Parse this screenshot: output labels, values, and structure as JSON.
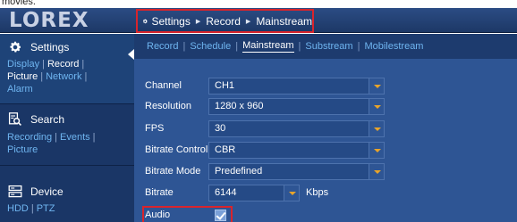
{
  "caption": "movies.",
  "header": {
    "logo": "LOREX",
    "breadcrumb": [
      "Settings",
      "Record",
      "Mainstream"
    ],
    "highlight_color": "#d8242c"
  },
  "sidebar": {
    "settings": {
      "title": "Settings",
      "links_row1": [
        "Display",
        "Record"
      ],
      "links_row2": [
        "Picture",
        "Network"
      ],
      "links_row3": [
        "Alarm"
      ]
    },
    "search": {
      "title": "Search",
      "links_row1": [
        "Recording",
        "Events"
      ],
      "links_row2": [
        "Picture"
      ]
    },
    "device": {
      "title": "Device",
      "links_row1": [
        "HDD",
        "PTZ"
      ]
    }
  },
  "tabs": [
    "Record",
    "Schedule",
    "Mainstream",
    "Substream",
    "Mobilestream"
  ],
  "selected_tab": "Mainstream",
  "form": {
    "channel": {
      "label": "Channel",
      "value": "CH1"
    },
    "resolution": {
      "label": "Resolution",
      "value": "1280 x 960"
    },
    "fps": {
      "label": "FPS",
      "value": "30"
    },
    "bitrate_control": {
      "label": "Bitrate Control",
      "value": "CBR"
    },
    "bitrate_mode": {
      "label": "Bitrate Mode",
      "value": "Predefined"
    },
    "bitrate": {
      "label": "Bitrate",
      "value": "6144",
      "unit": "Kbps"
    },
    "audio": {
      "label": "Audio",
      "checked": true
    }
  }
}
